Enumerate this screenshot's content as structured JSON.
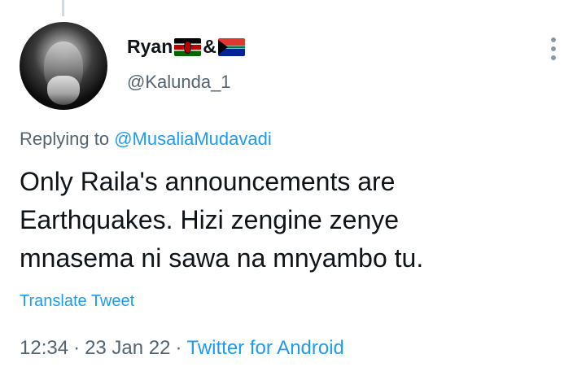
{
  "tweet": {
    "author": {
      "display_name": "Ryan",
      "name_separator": "&",
      "flags": [
        "kenya-flag",
        "south-africa-flag"
      ],
      "handle": "@Kalunda_1"
    },
    "replying_prefix": "Replying to ",
    "replying_to": "@MusaliaMudavadi",
    "text_lines": [
      "Only Raila's announcements are",
      "Earthquakes. Hizi zengine zenye",
      "mnasema ni sawa na mnyambo tu."
    ],
    "translate_label": "Translate Tweet",
    "time": "12:34",
    "date": "23 Jan 22",
    "source": "Twitter for Android",
    "dot": "·"
  },
  "colors": {
    "accent": "#1d9bf0",
    "secondary_text": "#536471",
    "primary_text": "#0f1419",
    "thread_line": "#cfd9de"
  }
}
